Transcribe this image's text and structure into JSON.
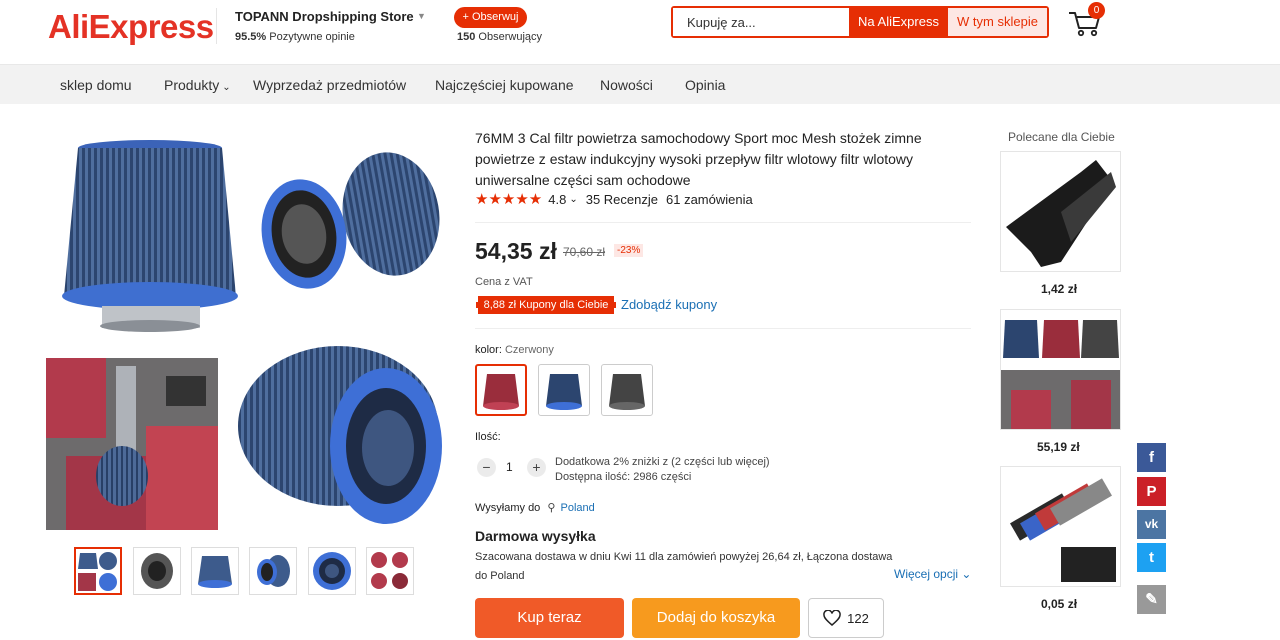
{
  "header": {
    "logo": "AliExpress",
    "store_name": "TOPANN Dropshipping Store",
    "store_rating": "95.5%",
    "store_rating_label": "Pozytywne opinie",
    "follow_label": "+ Obserwuj",
    "followers_count": "150",
    "followers_label": "Obserwujący",
    "search_placeholder": "Kupuję za...",
    "search_all_label": "Na AliExpress",
    "search_store_label": "W tym sklepie",
    "cart_count": "0"
  },
  "nav": {
    "items": [
      "sklep domu",
      "Produkty",
      "Wyprzedaż przedmiotów",
      "Najczęściej kupowane",
      "Nowości",
      "Opinia"
    ]
  },
  "product": {
    "title": "76MM 3 Cal filtr powietrza samochodowy Sport moc Mesh stożek zimne powietrze z estaw indukcyjny wysoki przepływ filtr wlotowy filtr wlotowy uniwersalne części sam ochodowe",
    "rating": "4.8",
    "reviews": "35 Recenzje",
    "orders": "61 zamówienia",
    "price": "54,35 zł",
    "old_price": "70,60 zł",
    "discount": "-23%",
    "vat_label": "Cena z VAT",
    "coupon_label": "8,88 zł Kupony dla Ciebie",
    "get_coupon_label": "Zdobądź kupony",
    "color_label": "kolor:",
    "color_value": "Czerwony",
    "qty_label": "Ilość:",
    "qty_value": "1",
    "qty_minus": "−",
    "qty_plus": "+",
    "qty_discount": "Dodatkowa 2% zniżki z (2 części lub więcej)",
    "qty_available": "Dostępna ilość: 2986 części",
    "ship_to_label": "Wysyłamy do",
    "ship_to_country": "Poland",
    "free_shipping": "Darmowa wysyłka",
    "delivery_desc_1": "Szacowana dostawa w dniu Kwi 11 dla zamówień powyżej 26,64 zł, Łączona dostawa",
    "delivery_desc_2": "do Poland",
    "more_options": "Więcej opcji",
    "buy_now": "Kup teraz",
    "add_to_cart": "Dodaj do koszyka",
    "wishlist_count": "122"
  },
  "recommended": {
    "title": "Polecane dla Ciebie",
    "items": [
      {
        "price": "1,42 zł"
      },
      {
        "price": "55,19 zł"
      },
      {
        "price": "0,05 zł"
      }
    ]
  },
  "social": [
    {
      "name": "facebook",
      "glyph": "f",
      "color": "#3b5998"
    },
    {
      "name": "pinterest",
      "glyph": "P",
      "color": "#cb2027"
    },
    {
      "name": "vk",
      "glyph": "vk",
      "color": "#4c75a3"
    },
    {
      "name": "twitter",
      "glyph": "t",
      "color": "#1da1f2"
    },
    {
      "name": "edit",
      "glyph": "✎",
      "color": "#999999"
    }
  ],
  "colors": {
    "accent": "#e62e04",
    "buy": "#f05a28",
    "cart": "#f79a1e",
    "link": "#1a6fb4"
  }
}
